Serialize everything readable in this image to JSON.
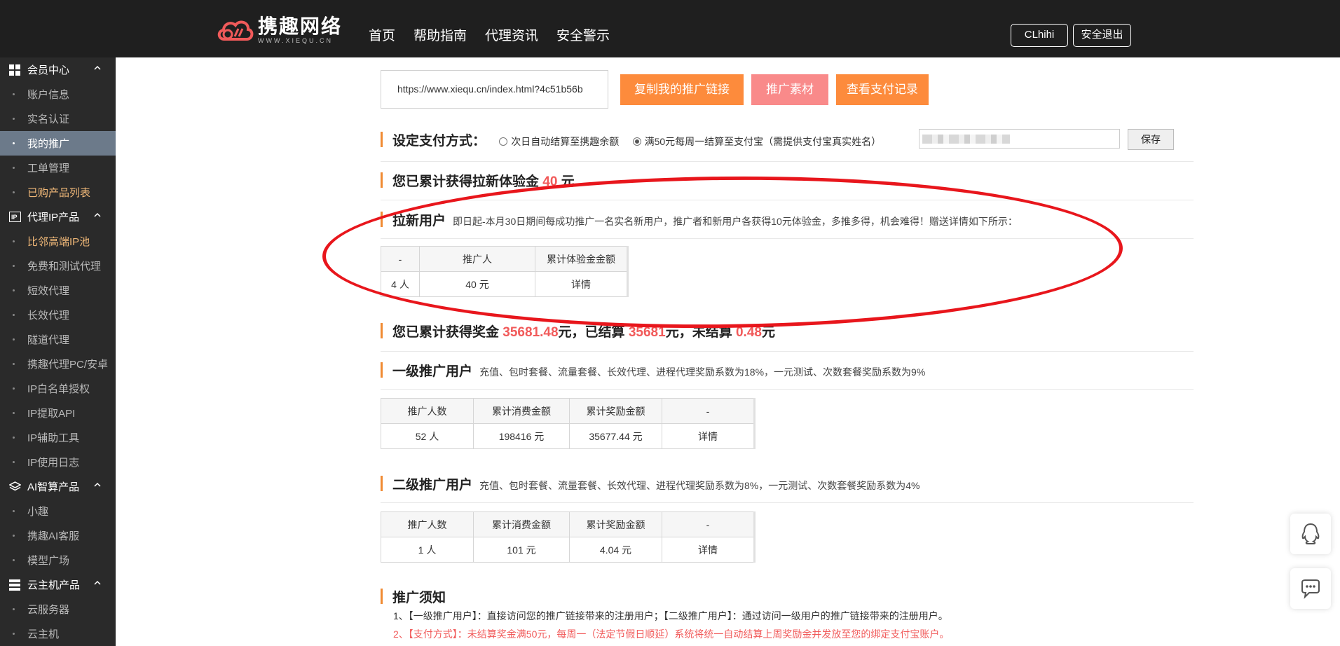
{
  "header": {
    "logo_cn": "携趣网络",
    "logo_en": "WWW.XIEQU.CN",
    "nav": [
      "首页",
      "帮助指南",
      "代理资讯",
      "安全警示"
    ],
    "username": "CLhihi",
    "logout": "安全退出"
  },
  "sidebar": {
    "groups": [
      {
        "title": "会员中心",
        "icon": "grid-icon",
        "items": [
          {
            "label": "账户信息"
          },
          {
            "label": "实名认证"
          },
          {
            "label": "我的推广"
          },
          {
            "label": "工单管理"
          },
          {
            "label": "已购产品列表"
          }
        ]
      },
      {
        "title": "代理IP产品",
        "icon": "ip-icon",
        "items": [
          {
            "label": "比邻高端IP池"
          },
          {
            "label": "免费和测试代理"
          },
          {
            "label": "短效代理"
          },
          {
            "label": "长效代理"
          },
          {
            "label": "隧道代理"
          },
          {
            "label": "携趣代理PC/安卓"
          },
          {
            "label": "IP白名单授权"
          },
          {
            "label": "IP提取API"
          },
          {
            "label": "IP辅助工具"
          },
          {
            "label": "IP使用日志"
          }
        ]
      },
      {
        "title": "AI智算产品",
        "icon": "layers-icon",
        "items": [
          {
            "label": "小趣"
          },
          {
            "label": "携趣AI客服"
          },
          {
            "label": "模型广场"
          }
        ]
      },
      {
        "title": "云主机产品",
        "icon": "server-icon",
        "items": [
          {
            "label": "云服务器"
          },
          {
            "label": "云主机"
          }
        ]
      }
    ],
    "active_item": "我的推广",
    "highlight_color": "#f0b878",
    "active_bg": "#6c7a8a"
  },
  "promo_link": {
    "url": "https://www.xiequ.cn/index.html?4c51b56b",
    "copy_btn": "复制我的推广链接",
    "material_btn": "推广素材",
    "payment_record_btn": "查看支付记录"
  },
  "payment": {
    "title": "设定支付方式：",
    "option1": "次日自动结算至携趣余额",
    "option2": "满50元每周一结算至支付宝（需提供支付宝真实姓名）",
    "selected": "option2",
    "save": "保存"
  },
  "newuser": {
    "title_prefix": "您已累计获得拉新体验金",
    "amount": "40",
    "unit": "元",
    "sub_title": "拉新用户",
    "sub_desc": "即日起-本月30日期间每成功推广一名实名新用户，推广者和新用户各获得10元体验金，多推多得，机会难得！赠送详情如下所示：",
    "table": {
      "headers": [
        "-",
        "推广人",
        "累计体验金金额"
      ],
      "row": [
        "4 人",
        "40 元",
        "详情"
      ]
    }
  },
  "bonus": {
    "p1": "您已累计获得奖金",
    "total": "35681.48",
    "p2": "元，已结算",
    "settled": "35681",
    "p3": "元，未结算",
    "unsettled": "0.48",
    "p4": "元"
  },
  "level1": {
    "title": "一级推广用户",
    "desc": "充值、包时套餐、流量套餐、长效代理、进程代理奖励系数为18%，一元测试、次数套餐奖励系数为9%",
    "headers": [
      "推广人数",
      "累计消费金额",
      "累计奖励金额",
      "-"
    ],
    "row": [
      "52 人",
      "198416 元",
      "35677.44 元",
      "详情"
    ]
  },
  "level2": {
    "title": "二级推广用户",
    "desc": "充值、包时套餐、流量套餐、长效代理、进程代理奖励系数为8%，一元测试、次数套餐奖励系数为4%",
    "headers": [
      "推广人数",
      "累计消费金额",
      "累计奖励金额",
      "-"
    ],
    "row": [
      "1 人",
      "101 元",
      "4.04 元",
      "详情"
    ]
  },
  "notice": {
    "title": "推广须知",
    "line1": "1、【一级推广用户】：直接访问您的推广链接带来的注册用户；【二级推广用户】：通过访问一级用户的推广链接带来的注册用户。",
    "line2": "2、【支付方式】：未结算奖金满50元，每周一（法定节假日顺延）系统将统一自动结算上周奖励金并发放至您的绑定支付宝账户。"
  },
  "colors": {
    "topbar": "#1f1f1f",
    "sidebar": "#2a2a2a",
    "orange_btn": "#fd8b3c",
    "pink_btn": "#f98a8a",
    "accent_red": "#f15a5a",
    "oval": "#e8161c"
  },
  "float_icons": [
    "qq-icon",
    "chat-icon"
  ]
}
